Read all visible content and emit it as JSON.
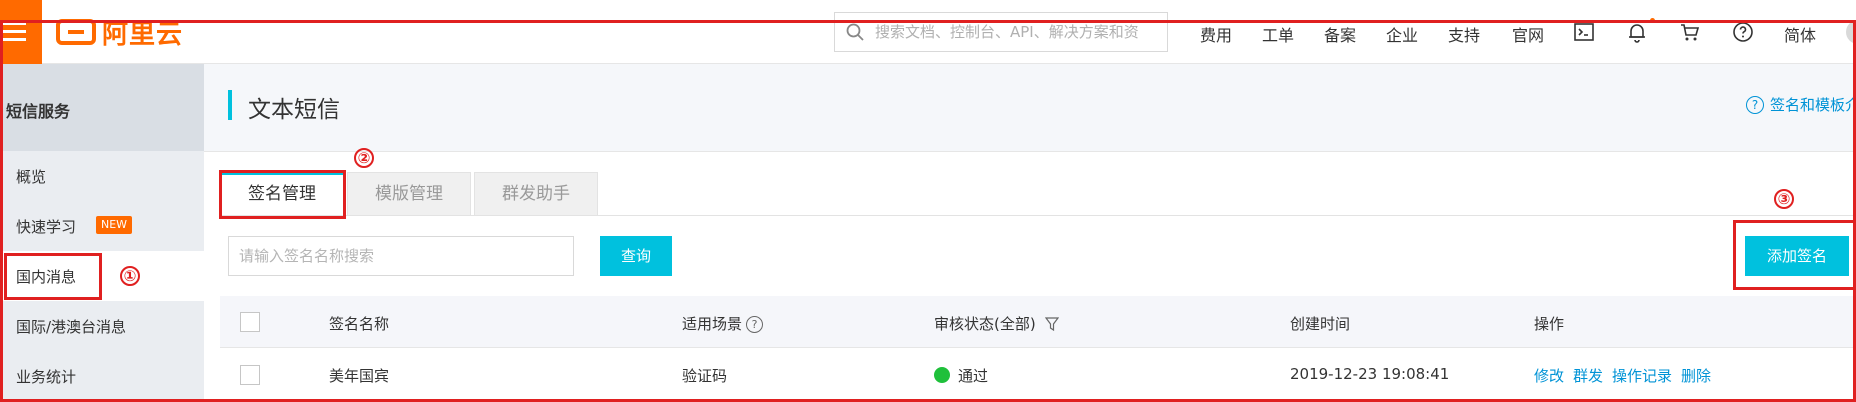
{
  "brand": {
    "logo_text": "阿里云",
    "color": "#ff6a00"
  },
  "search": {
    "placeholder": "搜索文档、控制台、API、解决方案和资"
  },
  "topnav": {
    "items": [
      "费用",
      "工单",
      "备案",
      "企业",
      "支持",
      "官网"
    ],
    "language": "简体",
    "icons": [
      "terminal-icon",
      "bell-icon",
      "cart-icon",
      "help-icon"
    ]
  },
  "sidebar": {
    "header": "短信服务",
    "items": [
      {
        "label": "概览"
      },
      {
        "label": "快速学习",
        "badge": "NEW"
      },
      {
        "label": "国内消息"
      },
      {
        "label": "国际/港澳台消息"
      },
      {
        "label": "业务统计"
      }
    ]
  },
  "main": {
    "title": "文本短信",
    "help_link": "签名和模板介",
    "tabs": [
      "签名管理",
      "模版管理",
      "群发助手"
    ],
    "filter": {
      "placeholder": "请输入签名名称搜索",
      "query_button": "查询"
    },
    "add_button": "添加签名",
    "table": {
      "headers": {
        "name": "签名名称",
        "scene": "适用场景",
        "status": "审核状态(全部)",
        "created": "创建时间",
        "ops": "操作"
      },
      "rows": [
        {
          "name": "美年国宾",
          "scene": "验证码",
          "status": "通过",
          "status_color": "#1fc03b",
          "created": "2019-12-23 19:08:41",
          "ops": [
            "修改",
            "群发",
            "操作记录",
            "删除"
          ]
        }
      ]
    }
  },
  "annotations": {
    "markers": [
      "①",
      "②",
      "③"
    ],
    "color": "#e02020"
  },
  "colors": {
    "accent": "#00c1de",
    "link": "#0093d6",
    "brand": "#ff6a00"
  }
}
